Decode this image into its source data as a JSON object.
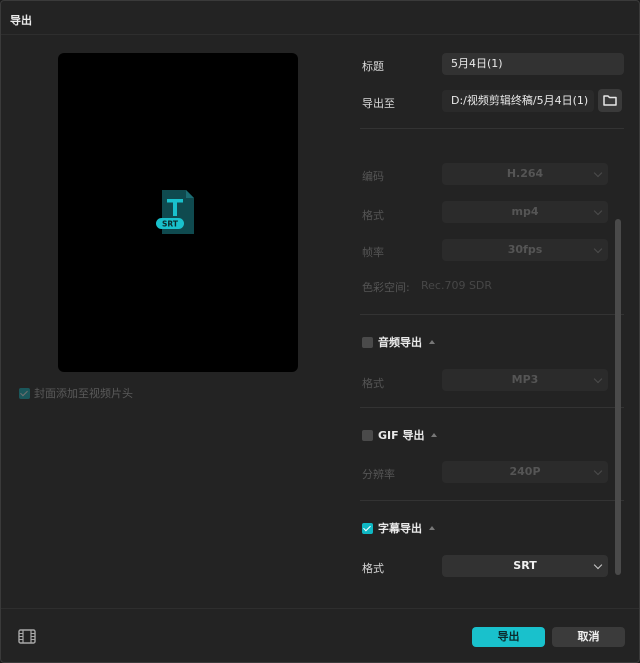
{
  "dialog": {
    "title": "导出"
  },
  "preview": {
    "file_badge": "SRT",
    "cover_option": "封面添加至视频片头",
    "cover_checked": true
  },
  "form": {
    "title_label": "标题",
    "title_value": "5月4日(1)",
    "export_to_label": "导出至",
    "export_path": "D:/视频剪辑终稿/5月4日(1)"
  },
  "video": {
    "encoding_label": "编码",
    "encoding_value": "H.264",
    "format_label": "格式",
    "format_value": "mp4",
    "fps_label": "帧率",
    "fps_value": "30fps",
    "colorspace_label": "色彩空间:",
    "colorspace_value": "Rec.709 SDR"
  },
  "audio": {
    "section_label": "音频导出",
    "checked": false,
    "format_label": "格式",
    "format_value": "MP3"
  },
  "gif": {
    "section_label": "GIF 导出",
    "checked": false,
    "resolution_label": "分辨率",
    "resolution_value": "240P"
  },
  "subtitle": {
    "section_label": "字幕导出",
    "checked": true,
    "format_label": "格式",
    "format_value": "SRT"
  },
  "footer": {
    "export_button": "导出",
    "cancel_button": "取消"
  },
  "colors": {
    "accent": "#19c1cc",
    "background": "#232323",
    "field": "#323232"
  }
}
